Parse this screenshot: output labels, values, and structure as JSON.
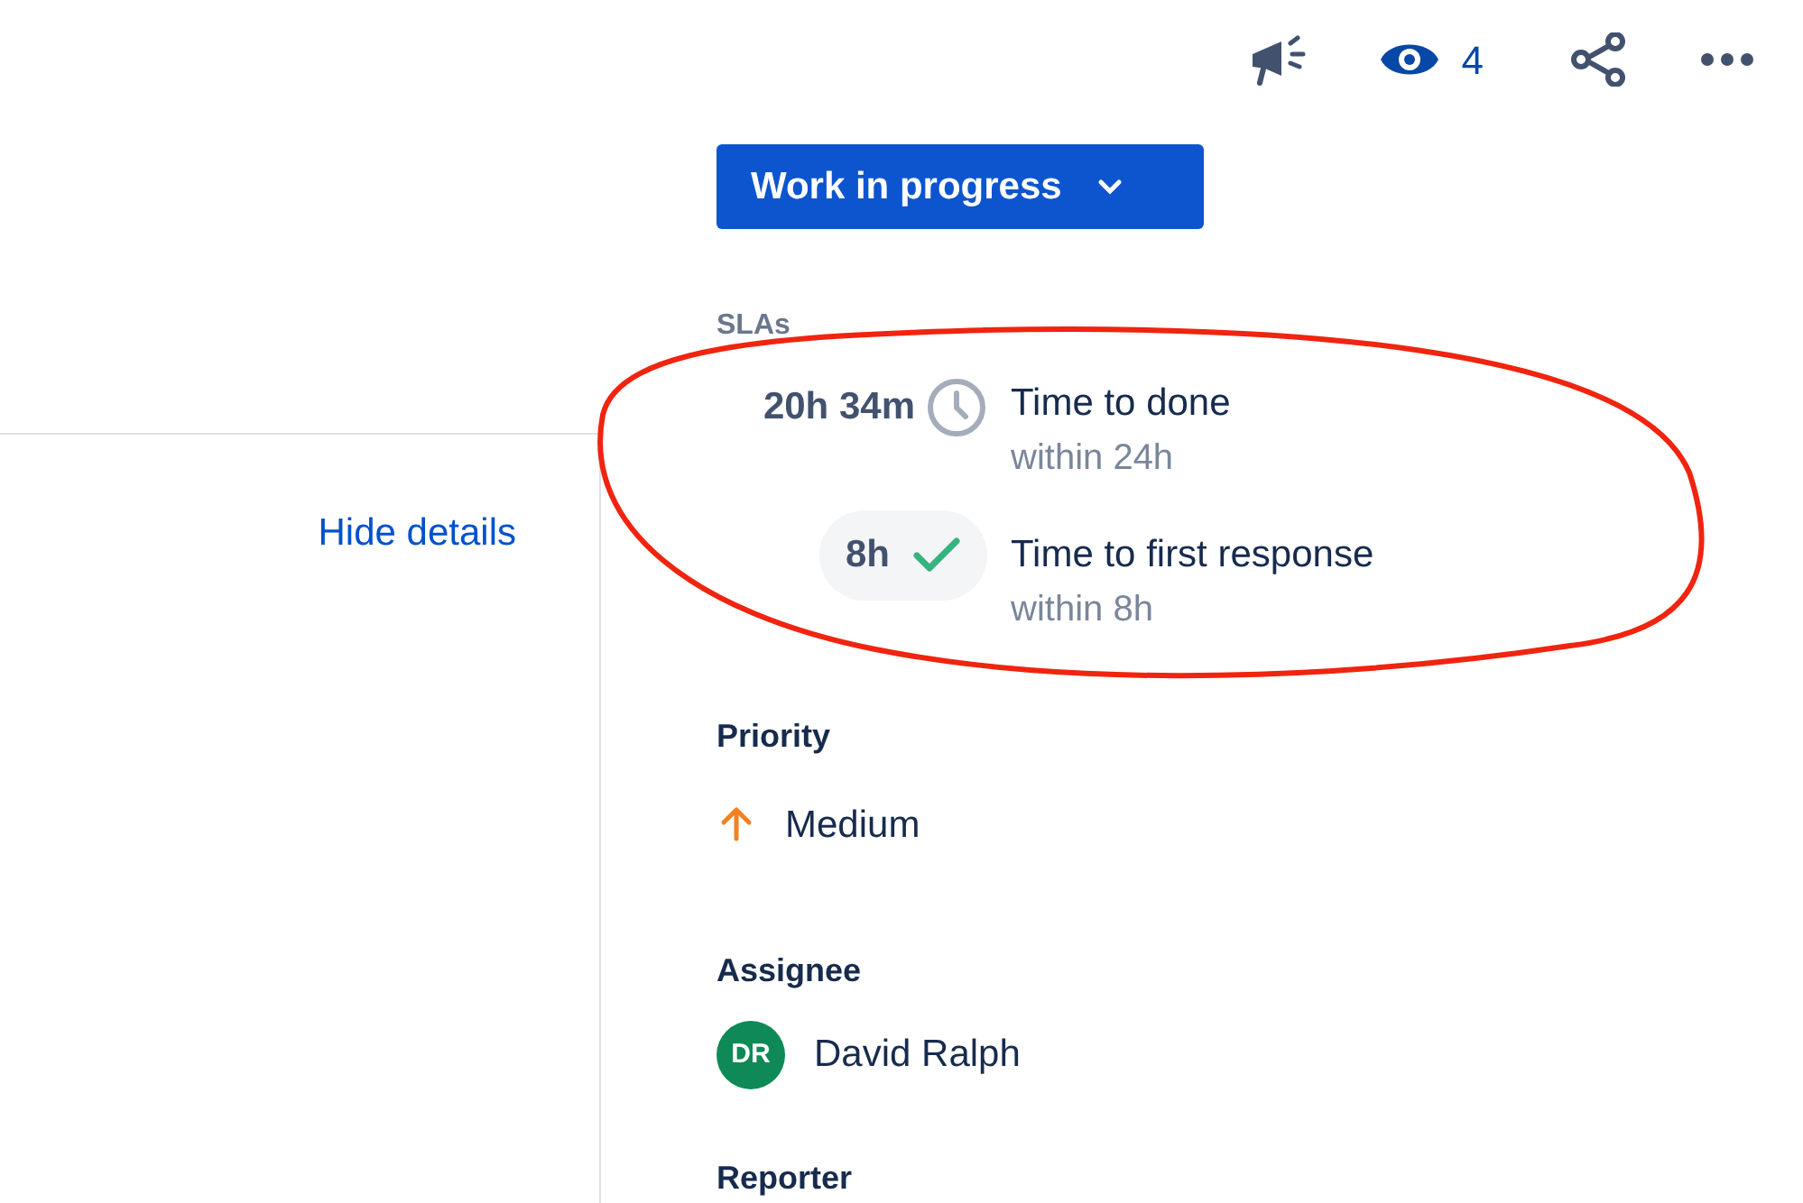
{
  "toolbar": {
    "watchers": "4"
  },
  "left_panel": {
    "hide_details": "Hide details"
  },
  "status_button": {
    "label": "Work in progress"
  },
  "slas": {
    "title": "SLAs",
    "items": [
      {
        "time": "20h 34m",
        "kind": "running",
        "name": "Time to done",
        "goal": "within 24h"
      },
      {
        "time": "8h",
        "kind": "met",
        "name": "Time to first response",
        "goal": "within 8h"
      }
    ]
  },
  "priority": {
    "label": "Priority",
    "value": "Medium"
  },
  "assignee": {
    "label": "Assignee",
    "initials": "DR",
    "name": "David Ralph"
  },
  "reporter": {
    "label": "Reporter"
  }
}
